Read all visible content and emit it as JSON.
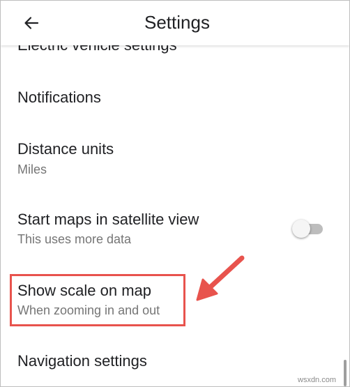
{
  "app_bar": {
    "title": "Settings",
    "back_icon": "arrow-left-icon"
  },
  "settings": {
    "partial_item": {
      "title": "Electric vehicle settings"
    },
    "items": [
      {
        "title": "Notifications"
      },
      {
        "title": "Distance units",
        "subtitle": "Miles"
      },
      {
        "title": "Start maps in satellite view",
        "subtitle": "This uses more data",
        "toggle_on": false
      },
      {
        "title": "Show scale on map",
        "subtitle": "When zooming in and out"
      },
      {
        "title": "Navigation settings"
      }
    ]
  },
  "annotation": {
    "highlight_color": "#e8534d",
    "arrow_icon": "pointer-arrow-icon"
  },
  "watermark": "wsxdn.com"
}
